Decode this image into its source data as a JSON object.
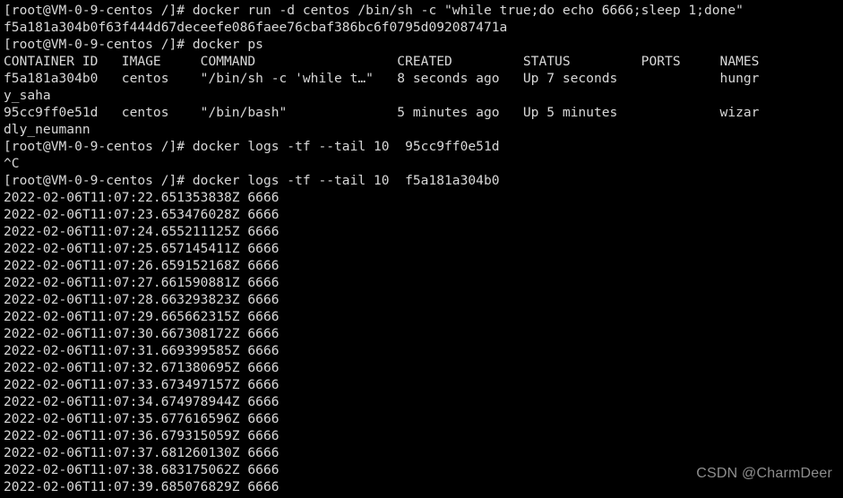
{
  "terminal": {
    "title": "root@VM-0-9-centos:/",
    "background_color": "#000000",
    "foreground_color": "#d8d8d8",
    "watermark": "CSDN @CharmDeer",
    "watermark_color": "#8e8e8e",
    "prompt": "[root@VM-0-9-centos /]#",
    "lines": [
      "[root@VM-0-9-centos /]# docker run -d centos /bin/sh -c \"while true;do echo 6666;sleep 1;done\"",
      "f5a181a304b0f63f444d67deceefe086faee76cbaf386bc6f0795d092087471a",
      "[root@VM-0-9-centos /]# docker ps",
      "CONTAINER ID   IMAGE     COMMAND                  CREATED         STATUS         PORTS     NAMES",
      "f5a181a304b0   centos    \"/bin/sh -c 'while t…\"   8 seconds ago   Up 7 seconds             hungr",
      "y_saha",
      "95cc9ff0e51d   centos    \"/bin/bash\"              5 minutes ago   Up 5 minutes             wizar",
      "dly_neumann",
      "[root@VM-0-9-centos /]# docker logs -tf --tail 10  95cc9ff0e51d",
      "^C",
      "[root@VM-0-9-centos /]# docker logs -tf --tail 10  f5a181a304b0",
      "2022-02-06T11:07:22.651353838Z 6666",
      "2022-02-06T11:07:23.653476028Z 6666",
      "2022-02-06T11:07:24.655211125Z 6666",
      "2022-02-06T11:07:25.657145411Z 6666",
      "2022-02-06T11:07:26.659152168Z 6666",
      "2022-02-06T11:07:27.661590881Z 6666",
      "2022-02-06T11:07:28.663293823Z 6666",
      "2022-02-06T11:07:29.665662315Z 6666",
      "2022-02-06T11:07:30.667308172Z 6666",
      "2022-02-06T11:07:31.669399585Z 6666",
      "2022-02-06T11:07:32.671380695Z 6666",
      "2022-02-06T11:07:33.673497157Z 6666",
      "2022-02-06T11:07:34.674978944Z 6666",
      "2022-02-06T11:07:35.677616596Z 6666",
      "2022-02-06T11:07:36.679315059Z 6666",
      "2022-02-06T11:07:37.681260130Z 6666",
      "2022-02-06T11:07:38.683175062Z 6666",
      "2022-02-06T11:07:39.685076829Z 6666"
    ],
    "commands": [
      "docker run -d centos /bin/sh -c \"while true;do echo 6666;sleep 1;done\"",
      "docker ps",
      "docker logs -tf --tail 10  95cc9ff0e51d",
      "docker logs -tf --tail 10  f5a181a304b0"
    ],
    "container_id_full": "f5a181a304b0f63f444d67deceefe086faee76cbaf386bc6f0795d092087471a",
    "interrupt_signal": "^C",
    "docker_ps_table": {
      "columns": [
        "CONTAINER ID",
        "IMAGE",
        "COMMAND",
        "CREATED",
        "STATUS",
        "PORTS",
        "NAMES"
      ],
      "rows": [
        {
          "container_id": "f5a181a304b0",
          "image": "centos",
          "command": "\"/bin/sh -c 'while t…\"",
          "created": "8 seconds ago",
          "status": "Up 7 seconds",
          "ports": "",
          "names": "hungry_saha"
        },
        {
          "container_id": "95cc9ff0e51d",
          "image": "centos",
          "command": "\"/bin/bash\"",
          "created": "5 minutes ago",
          "status": "Up 5 minutes",
          "ports": "",
          "names": "wizardly_neumann"
        }
      ]
    },
    "log_entries": [
      {
        "timestamp": "2022-02-06T11:07:22.651353838Z",
        "message": "6666"
      },
      {
        "timestamp": "2022-02-06T11:07:23.653476028Z",
        "message": "6666"
      },
      {
        "timestamp": "2022-02-06T11:07:24.655211125Z",
        "message": "6666"
      },
      {
        "timestamp": "2022-02-06T11:07:25.657145411Z",
        "message": "6666"
      },
      {
        "timestamp": "2022-02-06T11:07:26.659152168Z",
        "message": "6666"
      },
      {
        "timestamp": "2022-02-06T11:07:27.661590881Z",
        "message": "6666"
      },
      {
        "timestamp": "2022-02-06T11:07:28.663293823Z",
        "message": "6666"
      },
      {
        "timestamp": "2022-02-06T11:07:29.665662315Z",
        "message": "6666"
      },
      {
        "timestamp": "2022-02-06T11:07:30.667308172Z",
        "message": "6666"
      },
      {
        "timestamp": "2022-02-06T11:07:31.669399585Z",
        "message": "6666"
      },
      {
        "timestamp": "2022-02-06T11:07:32.671380695Z",
        "message": "6666"
      },
      {
        "timestamp": "2022-02-06T11:07:33.673497157Z",
        "message": "6666"
      },
      {
        "timestamp": "2022-02-06T11:07:34.674978944Z",
        "message": "6666"
      },
      {
        "timestamp": "2022-02-06T11:07:35.677616596Z",
        "message": "6666"
      },
      {
        "timestamp": "2022-02-06T11:07:36.679315059Z",
        "message": "6666"
      },
      {
        "timestamp": "2022-02-06T11:07:37.681260130Z",
        "message": "6666"
      },
      {
        "timestamp": "2022-02-06T11:07:38.683175062Z",
        "message": "6666"
      },
      {
        "timestamp": "2022-02-06T11:07:39.685076829Z",
        "message": "6666"
      }
    ]
  }
}
